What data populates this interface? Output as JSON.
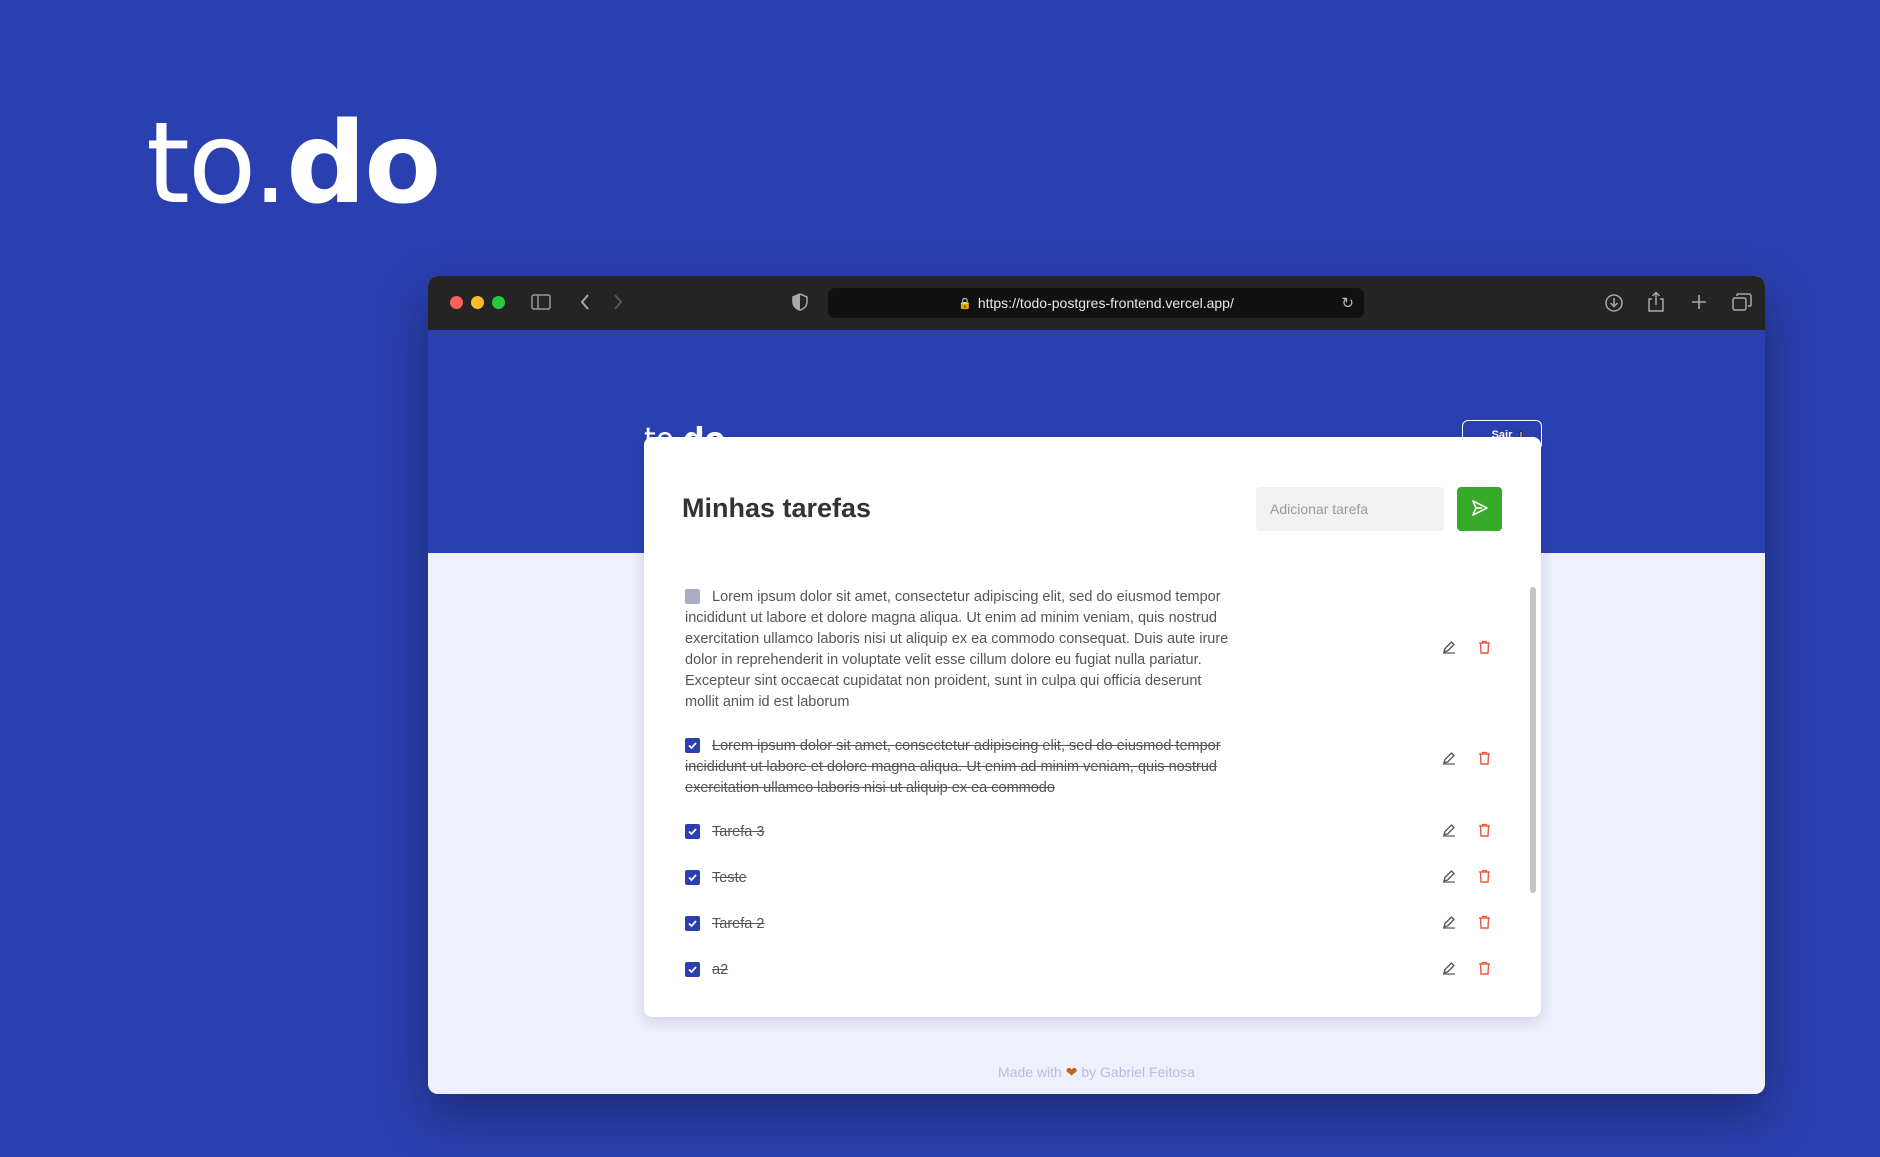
{
  "hero": {
    "logo_part1": "to.",
    "logo_part2": "do"
  },
  "browser": {
    "url": "https://todo-postgres-frontend.vercel.app/",
    "icons": [
      "sidebar-icon",
      "back-icon",
      "forward-icon",
      "shield-icon",
      "lock-icon",
      "reload-icon",
      "download-icon",
      "share-icon",
      "new-tab-icon",
      "tabs-overview-icon"
    ]
  },
  "app": {
    "logo_part1": "to.",
    "logo_part2": "do",
    "logout_label": "Sair",
    "title": "Minhas tarefas",
    "add_placeholder": "Adicionar tarefa",
    "colors": {
      "brand": "#2a40b0",
      "accent": "#36a82a",
      "delete": "#e8573f"
    },
    "tasks": [
      {
        "text": "Lorem ipsum dolor sit amet, consectetur adipiscing elit, sed do eiusmod tempor incididunt ut labore et dolore magna aliqua. Ut enim ad minim veniam, quis nostrud exercitation ullamco laboris nisi ut aliquip ex ea commodo consequat. Duis aute irure dolor in reprehenderit in voluptate velit esse cillum dolore eu fugiat nulla pariatur. Excepteur sint occaecat cupidatat non proident, sunt in culpa qui officia deserunt mollit anim id est laborum",
        "done": false
      },
      {
        "text": "Lorem ipsum dolor sit amet, consectetur adipiscing elit, sed do eiusmod tempor incididunt ut labore et dolore magna aliqua. Ut enim ad minim veniam, quis nostrud exercitation ullamco laboris nisi ut aliquip ex ea commodo",
        "done": true
      },
      {
        "text": "Tarefa 3",
        "done": true
      },
      {
        "text": "Teste",
        "done": true
      },
      {
        "text": "Tarefa 2",
        "done": true
      },
      {
        "text": "a2",
        "done": true
      }
    ],
    "footer": {
      "prefix": "Made with",
      "suffix": "by Gabriel Feitosa",
      "heart": "❤"
    }
  }
}
